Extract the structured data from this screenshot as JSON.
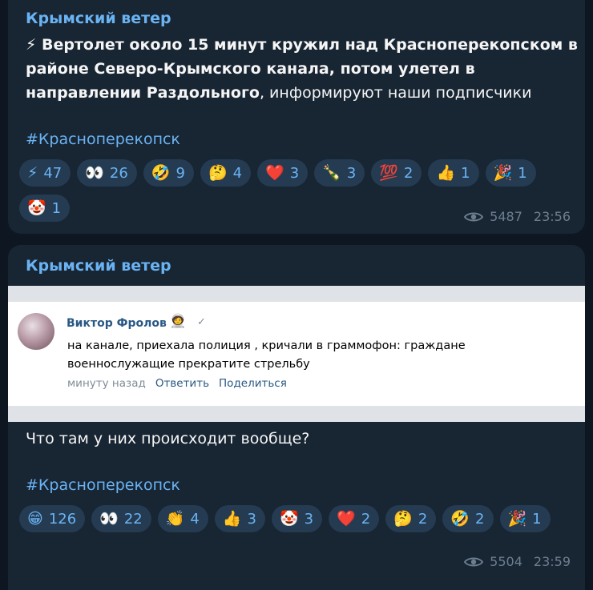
{
  "messages": [
    {
      "author": "Крымский ветер",
      "text_bold": "⚡ Вертолет около 15 минут кружил над Красноперекопском в районе Северо-Крымского канала, потом улетел в направлении Раздольного",
      "text_rest": ", информируют наши подписчики",
      "hashtag": "#Красноперекопск",
      "reactions": [
        {
          "emoji": "⚡",
          "count": "47"
        },
        {
          "emoji": "👀",
          "count": "26"
        },
        {
          "emoji": "🤣",
          "count": "9"
        },
        {
          "emoji": "🤔",
          "count": "4"
        },
        {
          "emoji": "❤️",
          "count": "3"
        },
        {
          "emoji": "🍾",
          "count": "3"
        },
        {
          "emoji": "💯",
          "count": "2"
        },
        {
          "emoji": "👍",
          "count": "1"
        },
        {
          "emoji": "🎉",
          "count": "1"
        },
        {
          "emoji": "🤡",
          "count": "1"
        }
      ],
      "views": "5487",
      "time": "23:56"
    },
    {
      "author": "Крымский ветер",
      "embed": {
        "name": "Виктор Фролов",
        "badge": "🧑‍🚀",
        "check": "✓",
        "text": "на канале, приехала полиция , кричали в граммофон: граждане военнослужащие прекратите стрельбу",
        "when": "минуту назад",
        "reply": "Ответить",
        "share": "Поделиться"
      },
      "text": "Что там у них происходит вообще?",
      "hashtag": "#Красноперекопск",
      "reactions": [
        {
          "emoji": "😁",
          "count": "126"
        },
        {
          "emoji": "👀",
          "count": "22"
        },
        {
          "emoji": "👏",
          "count": "4"
        },
        {
          "emoji": "👍",
          "count": "3"
        },
        {
          "emoji": "🤡",
          "count": "3"
        },
        {
          "emoji": "❤️",
          "count": "2"
        },
        {
          "emoji": "🤔",
          "count": "2"
        },
        {
          "emoji": "🤣",
          "count": "2"
        },
        {
          "emoji": "🎉",
          "count": "1"
        }
      ],
      "views": "5504",
      "time": "23:59"
    }
  ]
}
